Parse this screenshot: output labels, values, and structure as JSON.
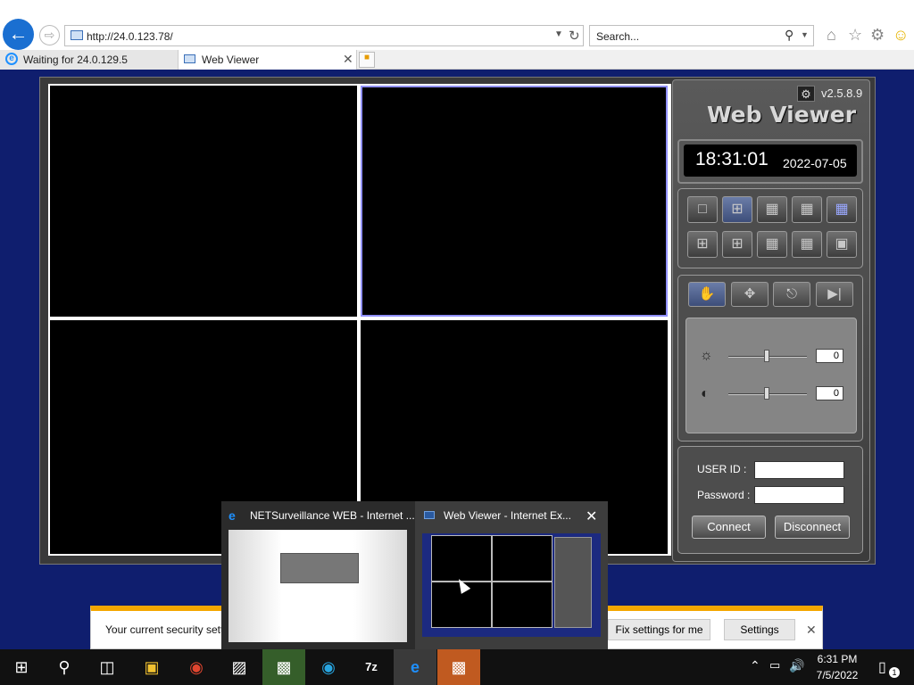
{
  "browser": {
    "url": "http://24.0.123.78/",
    "search_placeholder": "Search...",
    "tabs": [
      {
        "label": "Waiting for 24.0.129.5"
      },
      {
        "label": "Web Viewer"
      }
    ]
  },
  "viewer": {
    "version": "v2.5.8.9",
    "title": "Web Viewer",
    "time": "18:31:01",
    "date": "2022-07-05",
    "brightness_value": "0",
    "contrast_value": "0",
    "user_id_label": "USER ID :",
    "password_label": "Password :",
    "connect_label": "Connect",
    "disconnect_label": "Disconnect"
  },
  "infobar": {
    "message": "Your current security sett",
    "fix_label": "Fix settings for me",
    "settings_label": "Settings"
  },
  "thumbnails": [
    {
      "title": "NETSurveillance WEB - Internet ..."
    },
    {
      "title": "Web Viewer - Internet Ex..."
    }
  ],
  "taskbar": {
    "time": "6:31 PM",
    "date": "7/5/2022",
    "notification_count": "1",
    "apps": [
      "start-icon",
      "search-icon",
      "task-view-icon",
      "file-explorer-icon",
      "chrome-icon",
      "terminal-icon",
      "network-app-icon",
      "edge-icon",
      "7zip-icon",
      "internet-explorer-icon",
      "web-viewer-app-icon"
    ],
    "sevenzip_label": "7z"
  },
  "colors": {
    "page_bg": "#0f1e6e",
    "accent_blue": "#1a6fd1",
    "infobar_stripe": "#f5a700",
    "active_cell_border": "#9090ff"
  }
}
